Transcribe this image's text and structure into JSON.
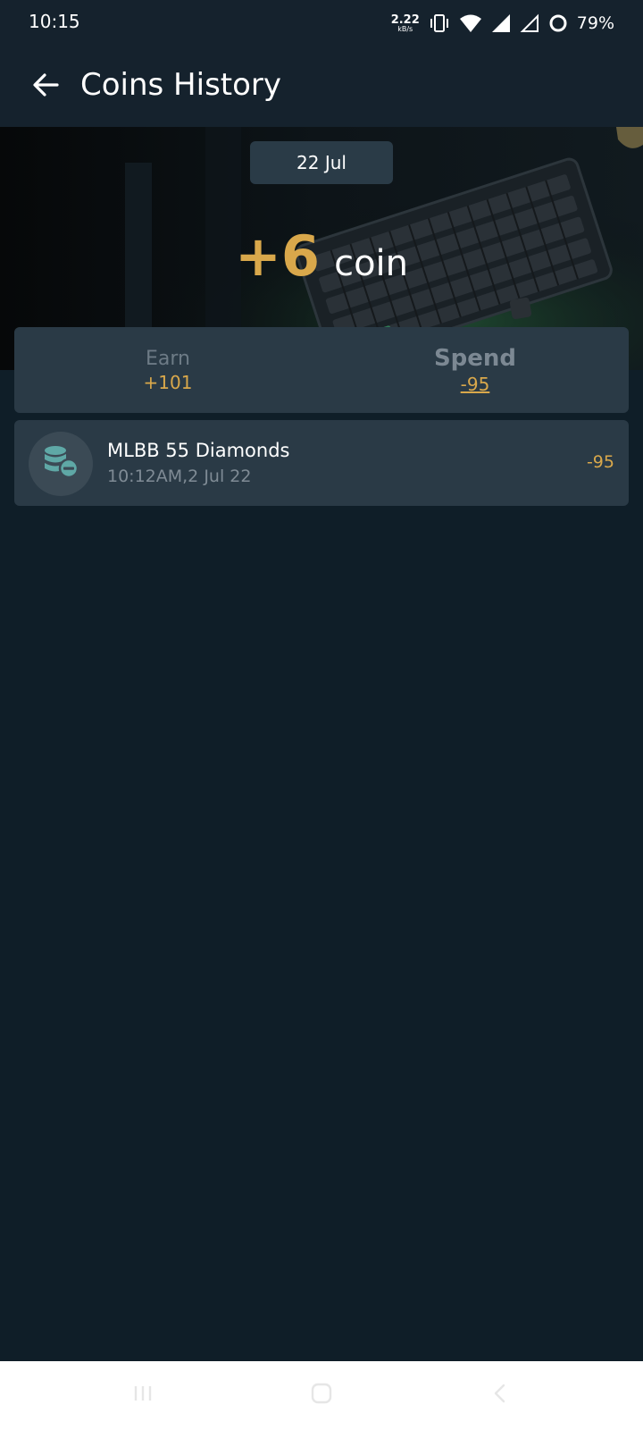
{
  "status_bar": {
    "time": "10:15",
    "net_speed": "2.22",
    "net_unit": "kB/s",
    "battery": "79%"
  },
  "header": {
    "title": "Coins History"
  },
  "summary": {
    "date": "22 Jul",
    "total_amount": "+6",
    "total_unit": "coin",
    "earn_label": "Earn",
    "earn_value": "+101",
    "spend_label": "Spend",
    "spend_value": "-95"
  },
  "transactions": [
    {
      "title": "MLBB 55 Diamonds",
      "datetime": "10:12AM,2 Jul 22",
      "amount": "-95",
      "icon": "coins-minus-icon"
    }
  ],
  "colors": {
    "background": "#0f1e28",
    "card": "#2a3a46",
    "accent_gold": "#d9a84b",
    "icon_teal": "#5fa8a6"
  }
}
